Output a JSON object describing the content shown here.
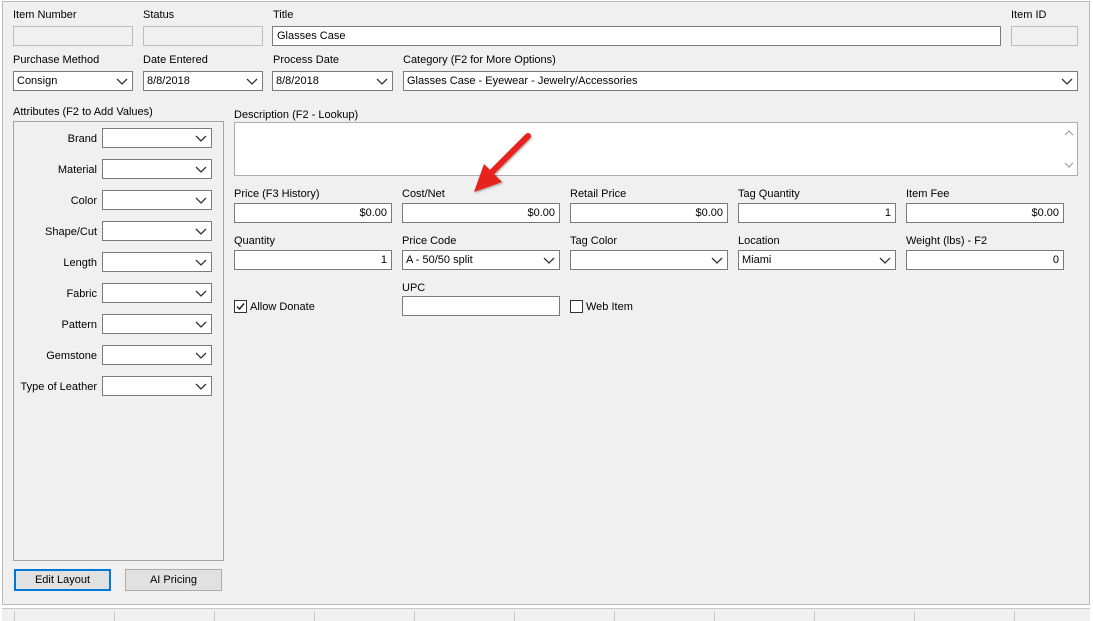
{
  "row1": {
    "item_number_label": "Item Number",
    "item_number_value": "",
    "status_label": "Status",
    "status_value": "",
    "title_label": "Title",
    "title_value": "Glasses Case",
    "item_id_label": "Item ID",
    "item_id_value": ""
  },
  "row2": {
    "purchase_method_label": "Purchase Method",
    "purchase_method_value": "Consign",
    "date_entered_label": "Date Entered",
    "date_entered_value": "8/8/2018",
    "process_date_label": "Process Date",
    "process_date_value": "8/8/2018",
    "category_label": "Category (F2 for More Options)",
    "category_value": "Glasses Case - Eyewear - Jewelry/Accessories"
  },
  "attributes": {
    "title": "Attributes (F2 to Add Values)",
    "items": [
      {
        "label": "Brand",
        "value": ""
      },
      {
        "label": "Material",
        "value": ""
      },
      {
        "label": "Color",
        "value": ""
      },
      {
        "label": "Shape/Cut",
        "value": ""
      },
      {
        "label": "Length",
        "value": ""
      },
      {
        "label": "Fabric",
        "value": ""
      },
      {
        "label": "Pattern",
        "value": ""
      },
      {
        "label": "Gemstone",
        "value": ""
      },
      {
        "label": "Type of Leather",
        "value": ""
      }
    ]
  },
  "description": {
    "label": "Description (F2 - Lookup)",
    "value": ""
  },
  "pricing": {
    "price_label": "Price (F3 History)",
    "price_value": "$0.00",
    "cost_label": "Cost/Net",
    "cost_value": "$0.00",
    "retail_label": "Retail Price",
    "retail_value": "$0.00",
    "tag_quantity_label": "Tag Quantity",
    "tag_quantity_value": "1",
    "item_fee_label": "Item Fee",
    "item_fee_value": "$0.00"
  },
  "details": {
    "quantity_label": "Quantity",
    "quantity_value": "1",
    "price_code_label": "Price Code",
    "price_code_value": "A - 50/50 split",
    "tag_color_label": "Tag Color",
    "tag_color_value": "",
    "location_label": "Location",
    "location_value": "Miami",
    "weight_label": "Weight (lbs) - F2",
    "weight_value": "0"
  },
  "extras": {
    "allow_donate_label": "Allow Donate",
    "allow_donate_checked": true,
    "upc_label": "UPC",
    "upc_value": "",
    "web_item_label": "Web Item",
    "web_item_checked": false
  },
  "buttons": {
    "edit_layout": "Edit Layout",
    "ai_pricing": "AI Pricing"
  },
  "colors": {
    "annotation_arrow": "#e8201a",
    "focus_border": "#0078d7"
  },
  "icons": {
    "dropdown": "chevron-down-icon",
    "check": "checkmark-icon",
    "annotation": "red-arrow-icon"
  }
}
